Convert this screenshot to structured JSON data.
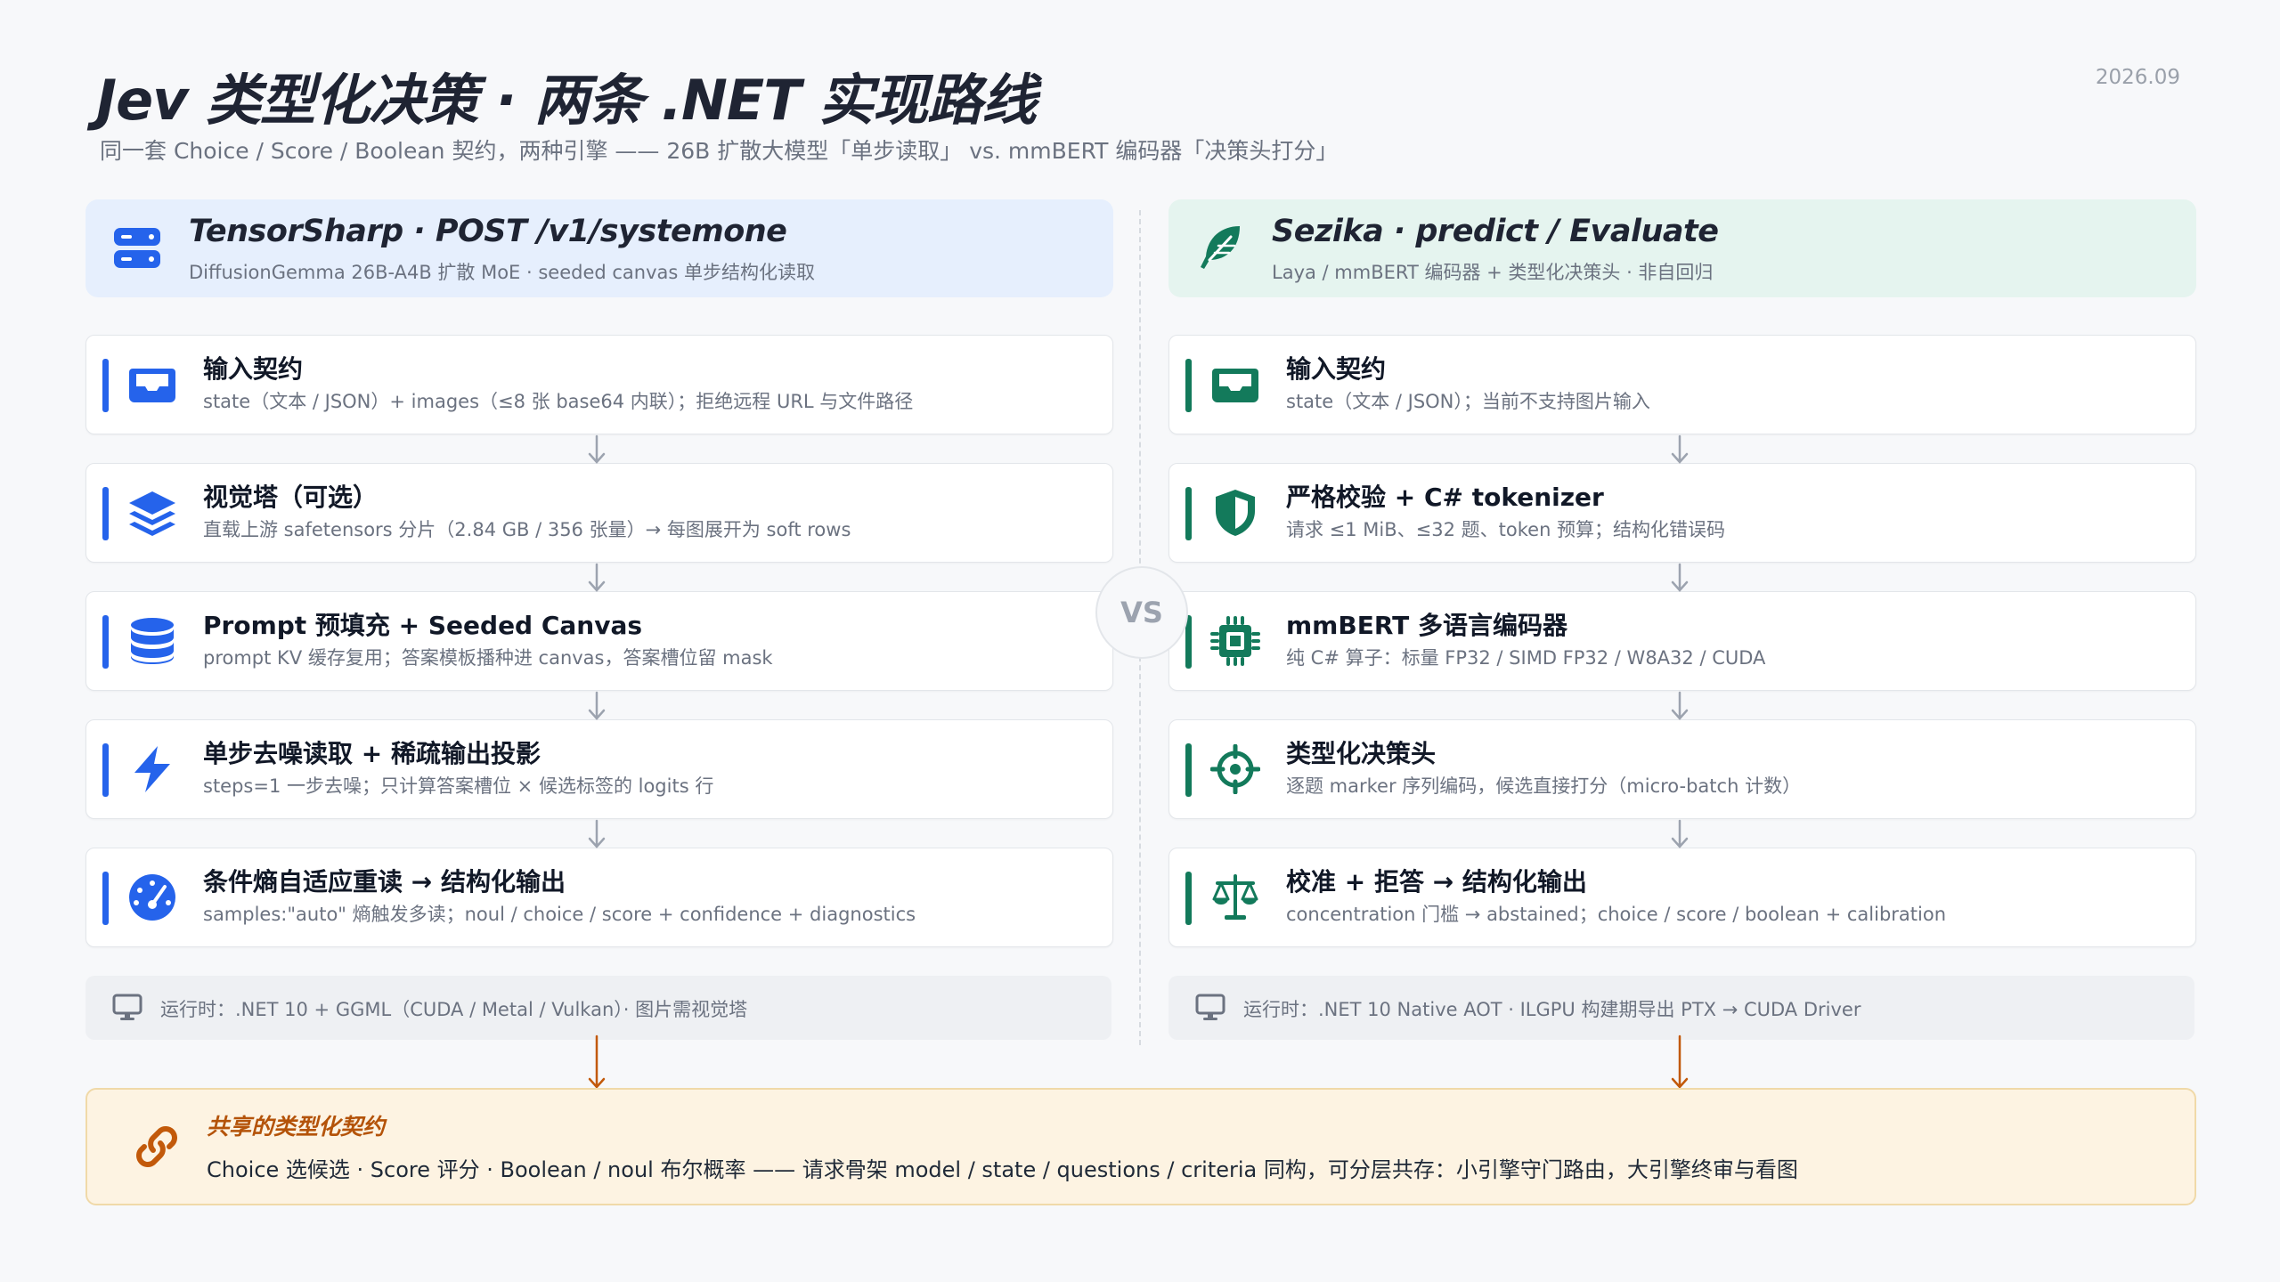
{
  "title": "Jev 类型化决策 · 两条 .NET 实现路线",
  "subtitle": "同一套 Choice / Score / Boolean 契约，两种引擎 —— 26B 扩散大模型「单步读取」 vs. mmBERT 编码器「决策头打分」",
  "date": "2026.09",
  "vs_label": "VS",
  "colors": {
    "blue": "#2563eb",
    "green": "#137a5b",
    "orange": "#b45309",
    "arrow_gray": "#9ca3af"
  },
  "left": {
    "header": {
      "icon": "server-icon",
      "title": "TensorSharp · POST /v1/systemone",
      "subtitle": "DiffusionGemma 26B-A4B 扩散 MoE · seeded canvas 单步结构化读取"
    },
    "steps": [
      {
        "icon": "inbox-icon",
        "title": "输入契约",
        "desc": "state（文本 / JSON）+ images（≤8 张 base64 内联）；拒绝远程 URL 与文件路径"
      },
      {
        "icon": "layers-icon",
        "title": "视觉塔（可选）",
        "desc": "直载上游 safetensors 分片（2.84 GB / 356 张量）→ 每图展开为 soft rows"
      },
      {
        "icon": "database-icon",
        "title": "Prompt 预填充 + Seeded Canvas",
        "desc": "prompt KV 缓存复用；答案模板播种进 canvas，答案槽位留 mask"
      },
      {
        "icon": "lightning-icon",
        "title": "单步去噪读取 + 稀疏输出投影",
        "desc": "steps=1 一步去噪；只计算答案槽位 × 候选标签的 logits 行"
      },
      {
        "icon": "gauge-icon",
        "title": "条件熵自适应重读 → 结构化输出",
        "desc": "samples:\"auto\" 熵触发多读；noul / choice / score + confidence + diagnostics"
      }
    ],
    "runtime": {
      "icon": "monitor-icon",
      "text": "运行时：.NET 10 + GGML（CUDA / Metal / Vulkan）· 图片需视觉塔"
    }
  },
  "right": {
    "header": {
      "icon": "feather-icon",
      "title": "Sezika · predict / Evaluate",
      "subtitle": "Laya / mmBERT 编码器 + 类型化决策头 · 非自回归"
    },
    "steps": [
      {
        "icon": "inbox-icon",
        "title": "输入契约",
        "desc": "state（文本 / JSON）；当前不支持图片输入"
      },
      {
        "icon": "shield-icon",
        "title": "严格校验 + C# tokenizer",
        "desc": "请求 ≤1 MiB、≤32 题、token 预算；结构化错误码"
      },
      {
        "icon": "chip-icon",
        "title": "mmBERT 多语言编码器",
        "desc": "纯 C# 算子：标量 FP32 / SIMD FP32 / W8A32 / CUDA"
      },
      {
        "icon": "crosshair-icon",
        "title": "类型化决策头",
        "desc": "逐题 marker 序列编码，候选直接打分（micro-batch 计数）"
      },
      {
        "icon": "scale-icon",
        "title": "校准 + 拒答 → 结构化输出",
        "desc": "concentration 门槛 → abstained；choice / score / boolean + calibration"
      }
    ],
    "runtime": {
      "icon": "monitor-icon",
      "text": "运行时：.NET 10 Native AOT · ILGPU 构建期导出 PTX → CUDA Driver"
    }
  },
  "shared": {
    "icon": "link-icon",
    "title": "共享的类型化契约",
    "text": "Choice 选候选 · Score 评分 · Boolean / noul 布尔概率 —— 请求骨架 model / state / questions / criteria 同构，可分层共存：小引擎守门路由，大引擎终审与看图"
  }
}
